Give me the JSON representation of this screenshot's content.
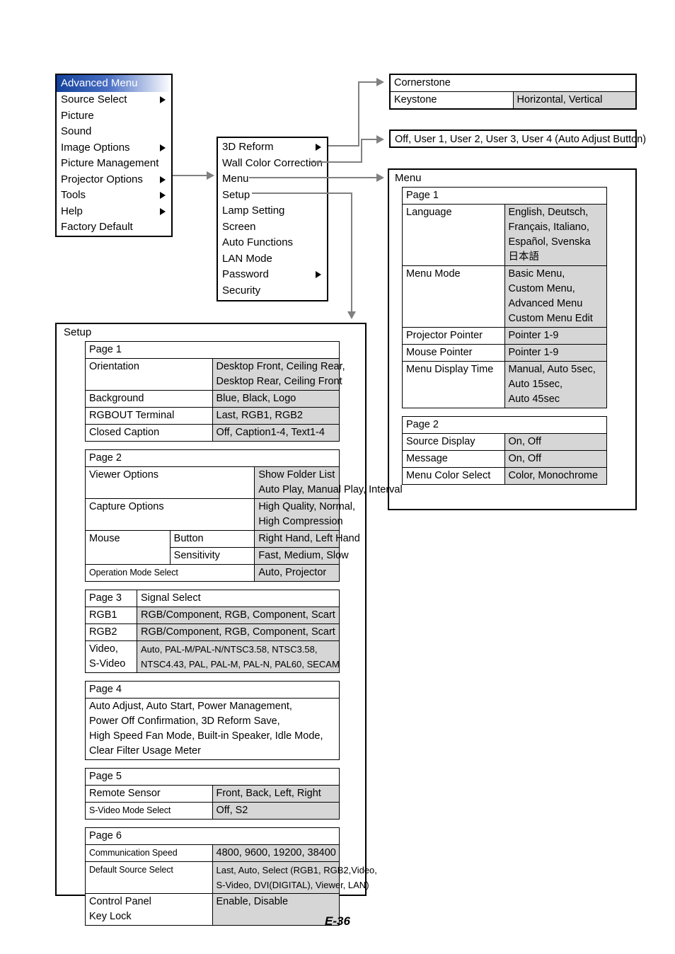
{
  "page": {
    "footer": "E-36"
  },
  "advanced_menu": {
    "title": "Advanced Menu",
    "items": [
      {
        "label": "Source Select",
        "submenu": true
      },
      {
        "label": "Picture",
        "submenu": false
      },
      {
        "label": "Sound",
        "submenu": false
      },
      {
        "label": "Image Options",
        "submenu": true
      },
      {
        "label": "Picture Management",
        "submenu": false
      },
      {
        "label": "Projector Options",
        "submenu": true
      },
      {
        "label": "Tools",
        "submenu": true
      },
      {
        "label": "Help",
        "submenu": true
      },
      {
        "label": "Factory Default",
        "submenu": false
      }
    ]
  },
  "projector_options_menu": {
    "items": [
      {
        "label": "3D Reform",
        "submenu": true
      },
      {
        "label": "Wall Color Correction",
        "submenu": false
      },
      {
        "label": "Menu",
        "submenu": false
      },
      {
        "label": "Setup",
        "submenu": false
      },
      {
        "label": "Lamp Setting",
        "submenu": false
      },
      {
        "label": "Screen",
        "submenu": false
      },
      {
        "label": "Auto Functions",
        "submenu": false
      },
      {
        "label": "LAN Mode",
        "submenu": false
      },
      {
        "label": "Password",
        "submenu": true
      },
      {
        "label": "Security",
        "submenu": false
      }
    ]
  },
  "reform_box": {
    "row1_label": "Cornerstone",
    "row2_label": "Keystone",
    "row2_value": "Horizontal, Vertical"
  },
  "wall_color_box": {
    "value": "Off, User 1, User 2, User 3, User 4 (Auto  Adjust Button)"
  },
  "menu_box": {
    "title": "Menu",
    "page1": {
      "header": "Page 1",
      "rows": [
        {
          "label": "Language",
          "values": [
            "English, Deutsch,",
            "Français, Italiano,",
            "Español, Svenska",
            "日本語"
          ]
        },
        {
          "label": "Menu Mode",
          "values": [
            "Basic Menu,",
            "Custom Menu,",
            "Advanced Menu",
            "Custom Menu Edit"
          ]
        },
        {
          "label": "Projector Pointer",
          "values": [
            "Pointer 1-9"
          ]
        },
        {
          "label": "Mouse Pointer",
          "values": [
            "Pointer 1-9"
          ]
        },
        {
          "label": "Menu Display Time",
          "values": [
            "Manual, Auto 5sec,",
            "Auto 15sec,",
            "Auto 45sec"
          ]
        }
      ]
    },
    "page2": {
      "header": "Page 2",
      "rows": [
        {
          "label": "Source Display",
          "values": [
            "On, Off"
          ]
        },
        {
          "label": "Message",
          "values": [
            "On, Off"
          ]
        },
        {
          "label": "Menu Color Select",
          "values": [
            "Color, Monochrome"
          ]
        }
      ]
    }
  },
  "setup_box": {
    "title": "Setup",
    "page1": {
      "header": "Page 1",
      "rows": [
        {
          "label": "Orientation",
          "values": [
            "Desktop Front, Ceiling Rear,",
            "Desktop Rear, Ceiling Front"
          ]
        },
        {
          "label": "Background",
          "values": [
            "Blue, Black, Logo"
          ]
        },
        {
          "label": "RGBOUT Terminal",
          "values": [
            "Last, RGB1, RGB2"
          ]
        },
        {
          "label": "Closed Caption",
          "values": [
            "Off, Caption1-4, Text1-4"
          ]
        }
      ]
    },
    "page2": {
      "header": "Page 2",
      "viewer_label": "Viewer Options",
      "viewer_values": [
        "Show Folder List",
        "Auto Play, Manual Play, Interval"
      ],
      "capture_label": "Capture Options",
      "capture_values": [
        "High Quality, Normal,",
        "High Compression"
      ],
      "mouse_label": "Mouse",
      "mouse_button_label": "Button",
      "mouse_button_value": "Right Hand, Left Hand",
      "mouse_sensitivity_label": "Sensitivity",
      "mouse_sensitivity_value": "Fast, Medium, Slow",
      "operation_label": "Operation Mode Select",
      "operation_value": "Auto, Projector"
    },
    "page3": {
      "header": "Page 3",
      "header_note": "Signal Select",
      "rows": [
        {
          "label": "RGB1",
          "values": [
            "RGB/Component, RGB, Component, Scart"
          ]
        },
        {
          "label": "RGB2",
          "values": [
            "RGB/Component, RGB, Component, Scart"
          ]
        }
      ],
      "video_label_line1": "Video,",
      "video_label_line2": "S-Video",
      "video_values": [
        "Auto, PAL-M/PAL-N/NTSC3.58, NTSC3.58,",
        "NTSC4.43, PAL, PAL-M, PAL-N, PAL60, SECAM"
      ]
    },
    "page4": {
      "header": "Page 4",
      "lines": [
        "Auto Adjust, Auto Start, Power Management,",
        "Power Off Confirmation, 3D Reform Save,",
        "High Speed Fan Mode, Built-in Speaker, Idle Mode,",
        "Clear Filter Usage Meter"
      ]
    },
    "page5": {
      "header": "Page 5",
      "rows": [
        {
          "label": "Remote Sensor",
          "values": [
            "Front, Back, Left, Right"
          ]
        },
        {
          "label": "S-Video Mode Select",
          "values": [
            "Off, S2"
          ]
        }
      ]
    },
    "page6": {
      "header": "Page 6",
      "comm_label": "Communication Speed",
      "comm_value": "4800, 9600, 19200, 38400",
      "default_label": "Default Source Select",
      "default_values": [
        "Last, Auto, Select (RGB1, RGB2,Video,",
        "S-Video, DVI(DIGITAL), Viewer, LAN)"
      ],
      "control_label_line1": "Control Panel",
      "control_label_line2": "Key Lock",
      "control_value": "Enable, Disable"
    }
  }
}
